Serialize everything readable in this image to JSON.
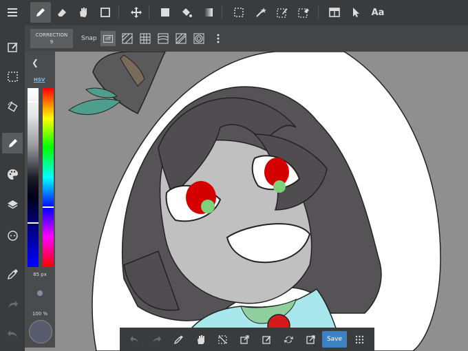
{
  "toolbar": {
    "text_tool_label": "Aa"
  },
  "subbar": {
    "correction_label": "CORRECTION",
    "correction_value": "9",
    "snap_label": "Snap",
    "snap_off_label": "off"
  },
  "color_panel": {
    "mode_label": "HSV",
    "brush_size": "85 px",
    "opacity": "100 %",
    "saturation_level": 0.75,
    "hue_level": 0.66
  },
  "bottombar": {
    "save_label": "Save"
  },
  "colors": {
    "toolbar_bg": "#3a3b3c",
    "accent": "#3b82c4",
    "current_color": "#595b6e"
  }
}
